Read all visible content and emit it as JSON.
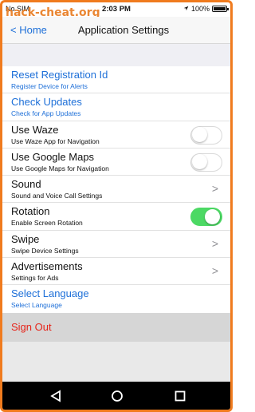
{
  "status_bar": {
    "carrier": "No SIM",
    "time": "2:03 PM",
    "battery": "100%",
    "battery_level": 1.0
  },
  "watermark": "hack-cheat.org",
  "nav": {
    "back_label": "< Home",
    "title": "Application Settings"
  },
  "settings": [
    {
      "title": "Reset Registration Id",
      "subtitle": "Register Device for Alerts"
    },
    {
      "title": "Check Updates",
      "subtitle": "Check for App Updates"
    },
    {
      "title": "Use Waze",
      "subtitle": "Use Waze App for Navigation",
      "toggle": false
    },
    {
      "title": "Use Google Maps",
      "subtitle": "Use Google Maps for Navigation",
      "toggle": false
    },
    {
      "title": "Sound",
      "subtitle": "Sound and Voice Call Settings",
      "chevron": ">"
    },
    {
      "title": "Rotation",
      "subtitle": "Enable Screen Rotation",
      "toggle": true
    },
    {
      "title": "Swipe",
      "subtitle": "Swipe Device Settings",
      "chevron": ">"
    },
    {
      "title": "Advertisements",
      "subtitle": "Settings for Ads",
      "chevron": ">"
    },
    {
      "title": "Select Language",
      "subtitle": "Select Language"
    }
  ],
  "sign_out": "Sign Out",
  "colors": {
    "link": "#1d6fd8",
    "toggle_on": "#4cd964",
    "danger": "#e6241a",
    "frame": "#f07b1e"
  }
}
